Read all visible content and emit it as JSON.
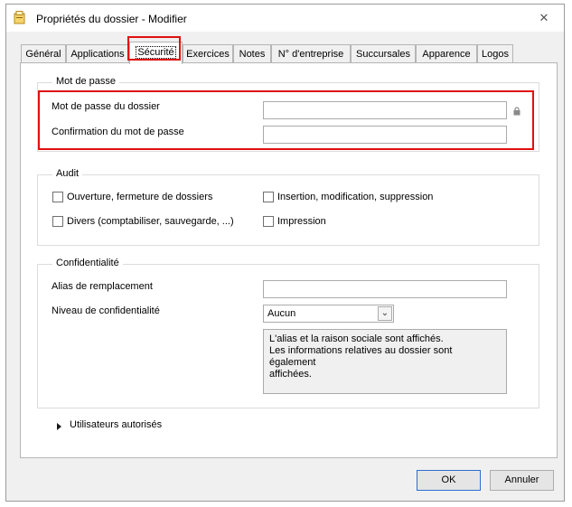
{
  "window": {
    "title": "Propriétés du dossier - Modifier"
  },
  "tabs": [
    {
      "label": "Général"
    },
    {
      "label": "Applications"
    },
    {
      "label": "Sécurité"
    },
    {
      "label": "Exercices"
    },
    {
      "label": "Notes"
    },
    {
      "label": "N° d'entreprise"
    },
    {
      "label": "Succursales"
    },
    {
      "label": "Apparence"
    },
    {
      "label": "Logos"
    }
  ],
  "active_tab": "Sécurité",
  "password_group": {
    "legend": "Mot de passe",
    "password_label": "Mot de passe du dossier",
    "password_value": "",
    "confirm_label": "Confirmation du mot de passe",
    "confirm_value": ""
  },
  "audit_group": {
    "legend": "Audit",
    "items": [
      {
        "label": "Ouverture, fermeture de dossiers",
        "checked": false
      },
      {
        "label": "Insertion, modification, suppression",
        "checked": false
      },
      {
        "label": "Divers (comptabiliser, sauvegarde, ...)",
        "checked": false
      },
      {
        "label": "Impression",
        "checked": false
      }
    ]
  },
  "confidentiality_group": {
    "legend": "Confidentialité",
    "alias_label": "Alias de remplacement",
    "alias_value": "",
    "level_label": "Niveau de confidentialité",
    "level_value": "Aucun",
    "info_line1": "L'alias et la raison sociale sont affichés.",
    "info_line2": "Les informations relatives au dossier sont également",
    "info_line3": "affichées."
  },
  "authorized_users": {
    "label": "Utilisateurs autorisés"
  },
  "buttons": {
    "ok": "OK",
    "cancel": "Annuler"
  },
  "colors": {
    "highlight": "#e01010",
    "window_bg": "#f0f0f0",
    "panel_bg": "#ffffff"
  }
}
